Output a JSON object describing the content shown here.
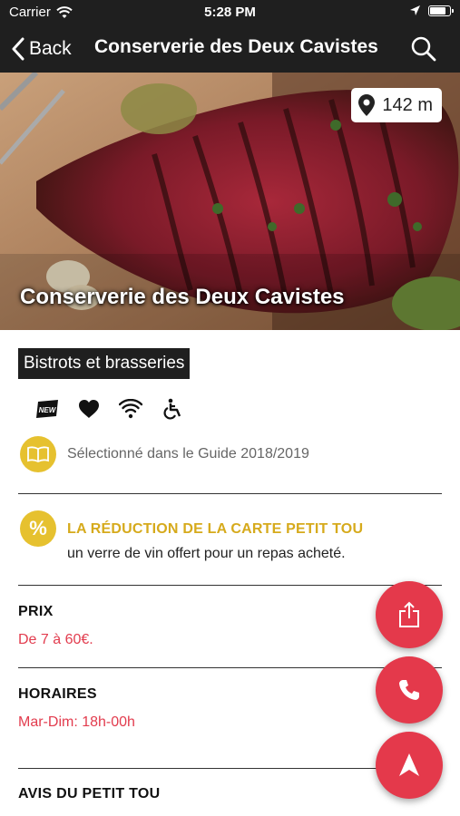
{
  "status_bar": {
    "carrier": "Carrier",
    "time": "5:28 PM"
  },
  "nav": {
    "back_label": "Back",
    "title": "Conserverie des Deux Cavistes"
  },
  "hero": {
    "distance": "142 m",
    "title": "Conserverie des Deux Cavistes"
  },
  "category": "Bistrots et brasseries",
  "amenities": [
    {
      "icon": "new-badge-icon",
      "label": "NEW"
    },
    {
      "icon": "heart-icon"
    },
    {
      "icon": "wifi-icon"
    },
    {
      "icon": "wheelchair-accessible-icon"
    }
  ],
  "guide": {
    "icon": "book-icon",
    "text": "Sélectionné dans le Guide 2018/2019"
  },
  "promo": {
    "icon": "percent-icon",
    "symbol": "%",
    "title": "LA RÉDUCTION DE LA CARTE PETIT TOU",
    "description": "un verre de vin offert pour un repas acheté."
  },
  "price": {
    "title": "PRIX",
    "value": "De 7 à 60€."
  },
  "hours": {
    "title": "HORAIRES",
    "value": "Mar-Dim: 18h-00h"
  },
  "reviews": {
    "title": "AVIS DU PETIT TOU"
  },
  "fabs": [
    "share-icon",
    "phone-icon",
    "navigation-arrow-icon"
  ],
  "colors": {
    "accent_red": "#e4394b",
    "gold": "#e6c12f",
    "dark_bar": "#1f1f1f"
  }
}
